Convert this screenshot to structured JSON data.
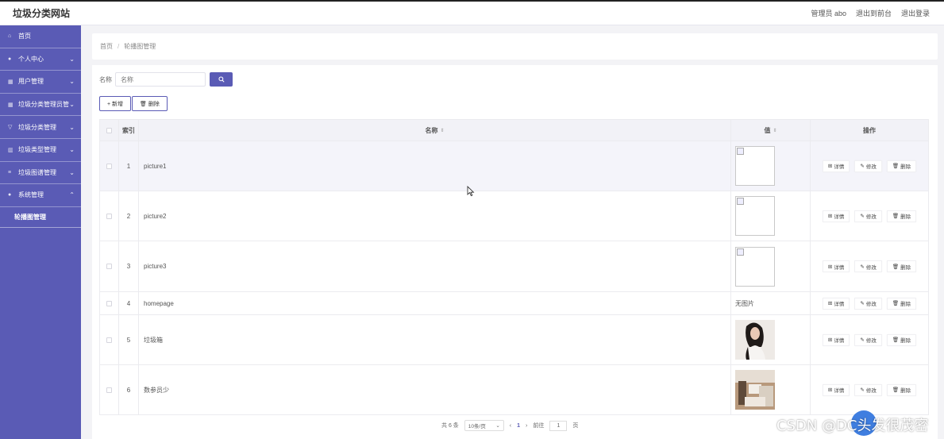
{
  "header": {
    "title": "垃圾分类网站",
    "nav": [
      "管理员 abo",
      "退出到前台",
      "退出登录"
    ]
  },
  "sidebar": {
    "items": [
      {
        "icon": "home-icon",
        "label": "首页",
        "chevron": ""
      },
      {
        "icon": "user-icon",
        "label": "个人中心",
        "chevron": "⌄"
      },
      {
        "icon": "grid-icon",
        "label": "用户管理",
        "chevron": "⌄"
      },
      {
        "icon": "grid-icon",
        "label": "垃圾分类管理员管理",
        "chevron": "⌄"
      },
      {
        "icon": "filter-icon",
        "label": "垃圾分类管理",
        "chevron": "⌄"
      },
      {
        "icon": "chart-icon",
        "label": "垃圾类型管理",
        "chevron": "⌄"
      },
      {
        "icon": "list-icon",
        "label": "垃圾图谱管理",
        "chevron": "⌄"
      },
      {
        "icon": "user-icon",
        "label": "系统管理",
        "chevron": "⌃"
      }
    ],
    "sub_item": "轮播图管理"
  },
  "breadcrumb": {
    "home": "首页",
    "sep": "/",
    "current": "轮播图管理"
  },
  "search": {
    "label": "名称",
    "placeholder": "名称"
  },
  "actions": {
    "add": "+ 新增",
    "delete": "🗑 删除"
  },
  "table": {
    "headers": {
      "index": "索引",
      "name": "名称",
      "value": "值",
      "ops": "操作",
      "sort": "⇕"
    },
    "ops": {
      "detail": "详情",
      "edit": "修改",
      "delete": "删除"
    },
    "rows": [
      {
        "index": "1",
        "name": "picture1",
        "value_type": "broken",
        "value_text": ""
      },
      {
        "index": "2",
        "name": "picture2",
        "value_type": "broken",
        "value_text": ""
      },
      {
        "index": "3",
        "name": "picture3",
        "value_type": "broken",
        "value_text": ""
      },
      {
        "index": "4",
        "name": "homepage",
        "value_type": "text",
        "value_text": "无图片"
      },
      {
        "index": "5",
        "name": "垃圾箱",
        "value_type": "portrait",
        "value_text": ""
      },
      {
        "index": "6",
        "name": "数参员少",
        "value_type": "room",
        "value_text": ""
      }
    ]
  },
  "pager": {
    "total": "共 6 条",
    "per_page": "10条/页",
    "prev": "‹",
    "page": "1",
    "next": "›",
    "goto": "前往",
    "goto_value": "1",
    "page_unit": "页"
  },
  "watermark": "CSDN @DC头发很茂密",
  "colors": {
    "accent": "#5a5bb5",
    "fab": "#3f7ee0"
  }
}
